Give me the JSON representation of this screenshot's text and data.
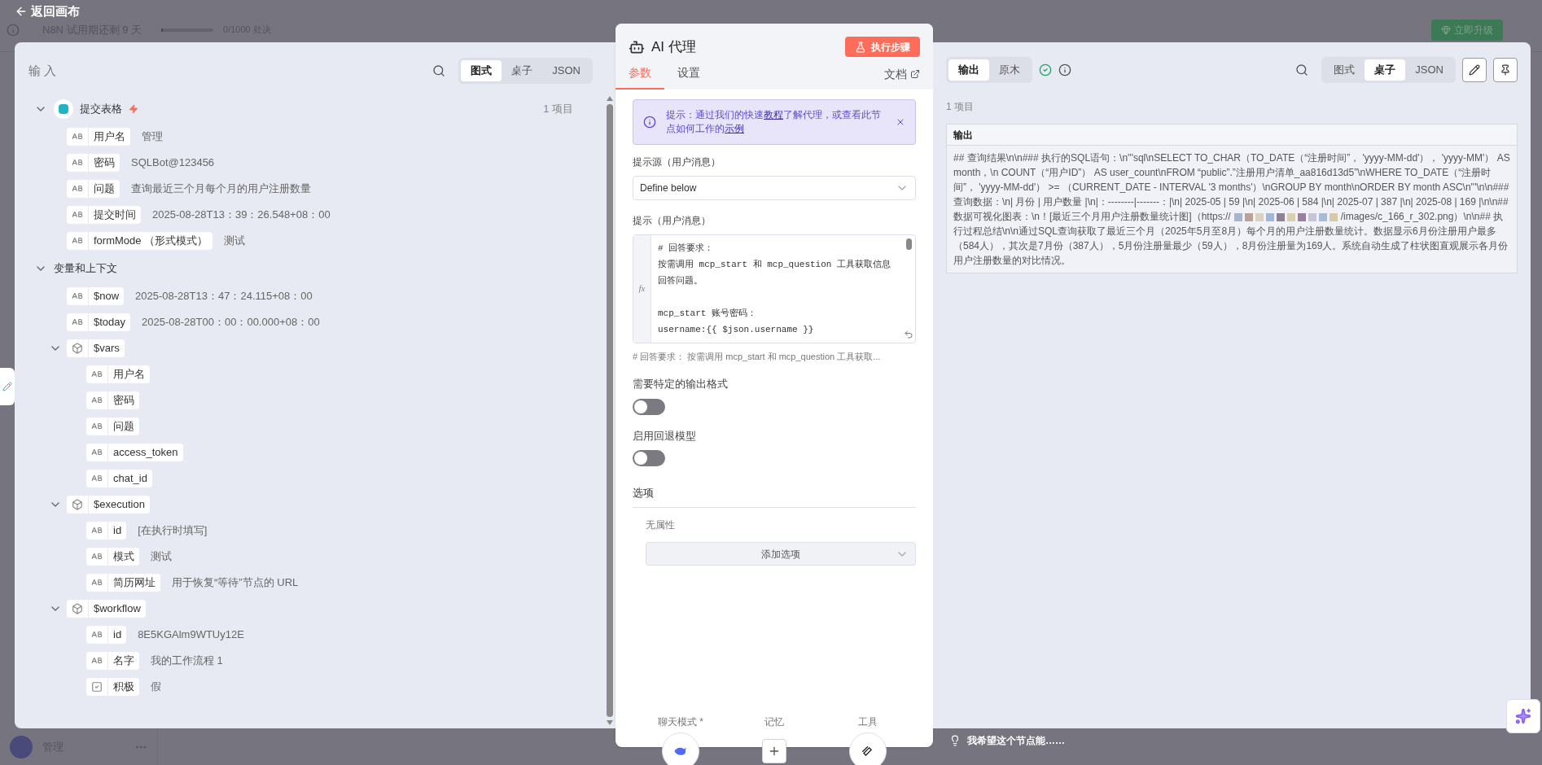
{
  "background": {
    "trial": "N8N 试用期还剩 9 天",
    "executions": {
      "level": 0.03,
      "text": "0/1000 处决"
    },
    "upgrade": "立即升级",
    "user": "管理"
  },
  "back": "返回画布",
  "input_panel": {
    "title": "输 入",
    "views": [
      {
        "label": "图式",
        "selected": true
      },
      {
        "label": "桌子",
        "selected": false
      },
      {
        "label": "JSON",
        "selected": false
      }
    ],
    "groups": [
      {
        "kind": "trigger",
        "label": "提交表格",
        "count": "1 项目",
        "expanded": true,
        "children": [
          {
            "kind": "string",
            "label": "用户名",
            "value": "管理"
          },
          {
            "kind": "string",
            "label": "密码",
            "value": "SQLBot@123456"
          },
          {
            "kind": "string",
            "label": "问题",
            "value": "查询最近三个月每个月的用户注册数量"
          },
          {
            "kind": "string",
            "label": "提交时间",
            "value": "2025-08-28T13：39：26.548+08：00"
          },
          {
            "kind": "string",
            "label": "formMode （形式模式）",
            "value": "测试"
          }
        ]
      },
      {
        "kind": "section",
        "label": "变量和上下文",
        "expanded": true,
        "children": [
          {
            "kind": "string",
            "label": "$now",
            "value": "2025-08-28T13：47：24.115+08：00"
          },
          {
            "kind": "string",
            "label": "$today",
            "value": "2025-08-28T00：00：00.000+08：00"
          },
          {
            "kind": "object",
            "label": "$vars",
            "expanded": true,
            "children": [
              {
                "kind": "string",
                "label": "用户名"
              },
              {
                "kind": "string",
                "label": "密码"
              },
              {
                "kind": "string",
                "label": "问题"
              },
              {
                "kind": "string",
                "label": "access_token"
              },
              {
                "kind": "string",
                "label": "chat_id"
              }
            ]
          },
          {
            "kind": "object",
            "label": "$execution",
            "expanded": true,
            "children": [
              {
                "kind": "string",
                "label": "id",
                "value": "[在执行时填写]"
              },
              {
                "kind": "string",
                "label": "模式",
                "value": "测试"
              },
              {
                "kind": "string",
                "label": "简历网址",
                "value": "用于恢复“等待”节点的 URL"
              }
            ]
          },
          {
            "kind": "object",
            "label": "$workflow",
            "expanded": true,
            "children": [
              {
                "kind": "string",
                "label": "id",
                "value": "8E5KGAlm9WTUy12E"
              },
              {
                "kind": "string",
                "label": "名字",
                "value": "我的工作流程 1"
              },
              {
                "kind": "boolean",
                "label": "积极",
                "value": "假"
              }
            ]
          }
        ]
      }
    ]
  },
  "node": {
    "title": "AI 代理",
    "run": "执行步骤",
    "tabs": [
      {
        "label": "参数",
        "selected": true
      },
      {
        "label": "设置",
        "selected": false
      }
    ],
    "docs": "文档",
    "callout": [
      {
        "kind": "text",
        "text": "提示：通过我们的快速"
      },
      {
        "kind": "link",
        "text": "教程"
      },
      {
        "kind": "text",
        "text": "了解代理，或查看此节点如何工作的"
      },
      {
        "kind": "link",
        "text": "示例"
      }
    ],
    "source_label": "提示源（用户消息）",
    "source_value": "Define below",
    "prompt_label": "提示（用户消息）",
    "gutter": "fx",
    "prompt_paragraphs": [
      [
        "# 回答要求：",
        "按需调用 mcp_start 和 mcp_question 工具获取信息回答问题。"
      ],
      [
        "mcp_start 账号密码：",
        "username:{{ $json.username }}"
      ]
    ],
    "prompt_hint": "# 回答要求： 按需调用 mcp_start 和 mcp_question 工具获取...",
    "toggles": [
      {
        "label": "需要特定的输出格式",
        "on": false
      },
      {
        "label": "启用回退模型",
        "on": false
      }
    ],
    "options_title": "选项",
    "options_empty": "无属性",
    "add_option": "添加选项",
    "connectors": [
      {
        "kind": "model",
        "label": "聊天模式 *"
      },
      {
        "kind": "add",
        "label": "记忆"
      },
      {
        "kind": "tool",
        "label": "工具"
      }
    ]
  },
  "output_panel": {
    "modes": [
      {
        "label": "输出",
        "selected": true
      },
      {
        "label": "原木",
        "selected": false
      }
    ],
    "views": [
      {
        "label": "图式",
        "selected": false
      },
      {
        "label": "桌子",
        "selected": true
      },
      {
        "label": "JSON",
        "selected": false
      }
    ],
    "count": "1 项目",
    "column": "输出",
    "cell": [
      {
        "kind": "text",
        "text": "## 查询结果\\n\\n### 执行的SQL语句：\\n'''sql\\nSELECT TO_CHAR（TO_DATE（“注册时间”， 'yyyy-MM-dd'）， 'yyyy-MM'） AS month，\\n COUNT（“用户ID”） AS user_count\\nFROM “public”.”注册用户清单_aa816d13d5”\\nWHERE TO_DATE（“注册时间”， 'yyyy-MM-dd'） >= （CURRENT_DATE - INTERVAL '3 months'）\\nGROUP BY month\\nORDER BY month ASC\\n'''\\n\\n### 查询数据：\\n| 月份 | 用户数量 |\\n|：--------|-------：|\\n| 2025-05 | 59 |\\n| 2025-06 | 584 |\\n| 2025-07 | 387 |\\n| 2025-08 | 169 |\\n\\n## 数据可视化图表：\\n！[最近三个月用户注册数量统计图]（https://"
      },
      {
        "kind": "redacted"
      },
      {
        "kind": "text",
        "text": "/images/c_166_r_302.png）\\n\\n## 执行过程总结\\n\\n通过SQL查询获取了最近三个月（2025年5月至8月）每个月的用户注册数量统计。数据显示6月份注册用户最多（584人），其次是7月份（387人），5月份注册量最少（59人），8月份注册量为169人。系统自动生成了柱状图直观展示各月份用户注册数量的对比情况。"
      }
    ]
  },
  "wish": "我希望这个节点能……"
}
